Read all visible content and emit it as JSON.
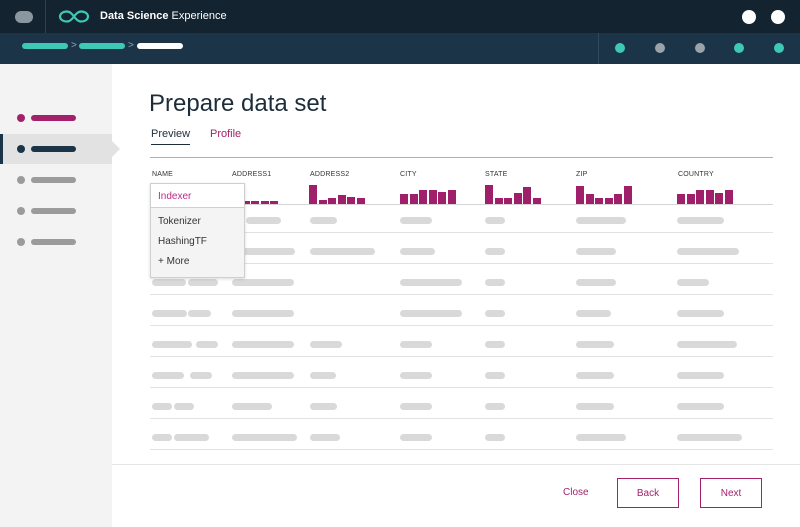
{
  "topbar": {
    "title_brand": "Data Science",
    "title_rest": " Experience",
    "logo_icon": "infinity-loop-logo",
    "menu_icon": "menu-toggle-icon",
    "bg_color": "#132330"
  },
  "progress": {
    "breadcrumb_separator": ">",
    "crumb_colors": [
      "#3ec9b5",
      "#3ec9b5",
      "#ffffff"
    ],
    "step_colors": [
      "#3ec9b5",
      "#9aa3aa",
      "#9aa3aa",
      "#3ec9b5",
      "#3ec9b5"
    ],
    "bg_color": "#1c3448"
  },
  "sidebar": {
    "items": [
      {
        "dot_color": "#a3216b",
        "bar_color": "#a3216b",
        "active": false
      },
      {
        "dot_color": "#1c3448",
        "bar_color": "#1c3448",
        "active": true
      },
      {
        "dot_color": "#9b9b9b",
        "bar_color": "#9b9b9b",
        "active": false
      },
      {
        "dot_color": "#9b9b9b",
        "bar_color": "#9b9b9b",
        "active": false
      },
      {
        "dot_color": "#9b9b9b",
        "bar_color": "#9b9b9b",
        "active": false
      }
    ]
  },
  "main": {
    "title": "Prepare data set",
    "tabs": [
      {
        "label": "Preview",
        "active": true
      },
      {
        "label": "Profile",
        "active": false
      }
    ],
    "columns": [
      {
        "name": "NAME",
        "histogram": []
      },
      {
        "name": "ADDRESS1",
        "histogram": [
          0.15,
          0.15,
          0.15,
          0.15,
          0.15
        ]
      },
      {
        "name": "ADDRESS2",
        "histogram": [
          1.0,
          0.2,
          0.3,
          0.45,
          0.35,
          0.3
        ]
      },
      {
        "name": "CITY",
        "histogram": [
          0.55,
          0.55,
          0.75,
          0.75,
          0.65,
          0.75
        ]
      },
      {
        "name": "STATE",
        "histogram": [
          1.0,
          0.3,
          0.3,
          0.6,
          0.9,
          0.3
        ]
      },
      {
        "name": "ZIP",
        "histogram": [
          0.95,
          0.55,
          0.3,
          0.3,
          0.55,
          0.95
        ]
      },
      {
        "name": "COUNTRY",
        "histogram": [
          0.55,
          0.55,
          0.75,
          0.75,
          0.6,
          0.75
        ]
      }
    ],
    "accent_color": "#a01f6a"
  },
  "dropdown": {
    "items": [
      "Indexer",
      "Tokenizer",
      "HashingTF",
      "+ More"
    ],
    "selected": "Indexer"
  },
  "footer": {
    "close_label": "Close",
    "back_label": "Back",
    "next_label": "Next"
  }
}
